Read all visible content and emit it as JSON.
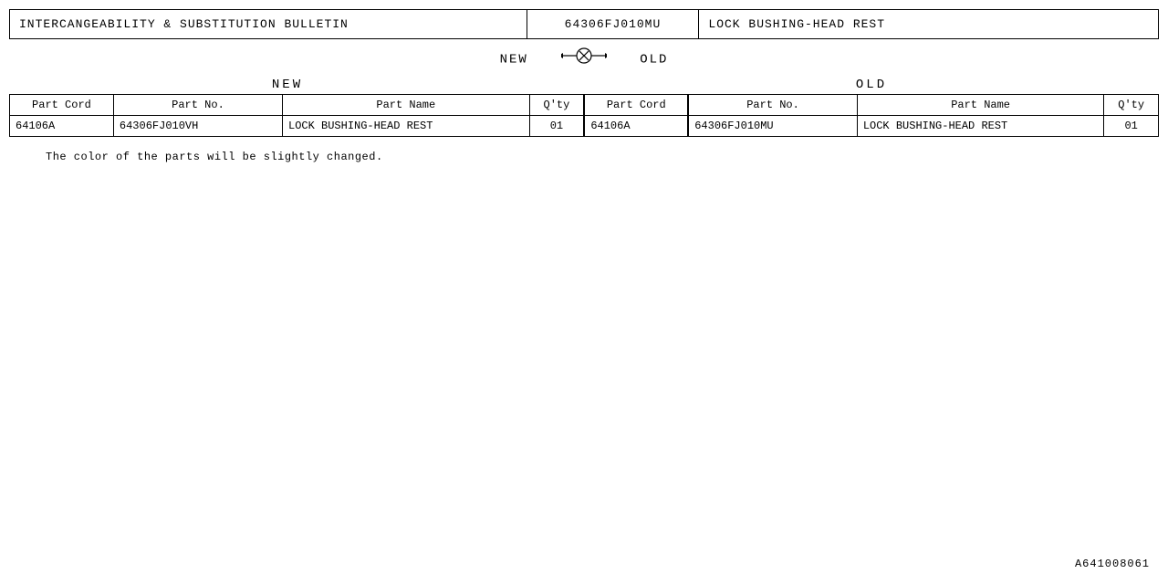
{
  "header": {
    "col1": "INTERCANGEABILITY & SUBSTITUTION BULLETIN",
    "col2": "64306FJ010MU",
    "col3": "LOCK BUSHING-HEAD REST"
  },
  "new_old_section": {
    "label_new": "NEW",
    "label_old": "OLD",
    "arrow_label": "NEW ↔ OLD"
  },
  "new_section_label": "NEW",
  "old_section_label": "OLD",
  "table": {
    "headers": {
      "part_cord": "Part Cord",
      "part_no": "Part No.",
      "part_name": "Part Name",
      "qty": "Q'ty",
      "part_cord_old": "Part Cord",
      "part_no_old": "Part No.",
      "part_name_old": "Part Name",
      "qty_old": "Q'ty"
    },
    "rows": [
      {
        "new_part_cord": "64106A",
        "new_part_no": "64306FJ010VH",
        "new_part_name": "LOCK BUSHING-HEAD REST",
        "new_qty": "01",
        "old_part_cord": "64106A",
        "old_part_no": "64306FJ010MU",
        "old_part_name": "LOCK BUSHING-HEAD REST",
        "old_qty": "01"
      }
    ]
  },
  "note": "The color of the parts will be slightly changed.",
  "doc_number": "A641008061"
}
